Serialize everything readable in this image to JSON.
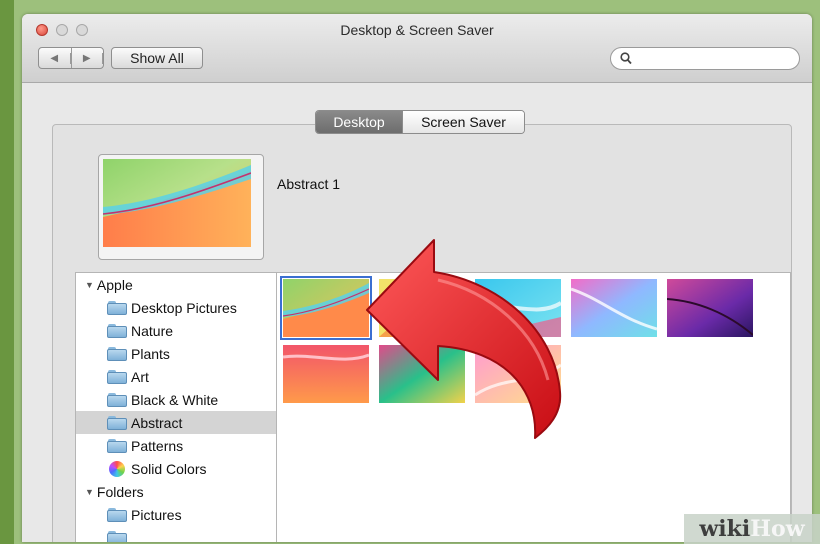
{
  "window": {
    "title": "Desktop & Screen Saver",
    "show_all_label": "Show All",
    "search_placeholder": ""
  },
  "tabs": [
    {
      "label": "Desktop",
      "selected": true
    },
    {
      "label": "Screen Saver",
      "selected": false
    }
  ],
  "current_wallpaper": {
    "name": "Abstract 1"
  },
  "sidebar": {
    "groups": [
      {
        "label": "Apple",
        "items": [
          {
            "label": "Desktop Pictures",
            "icon": "folder-icon"
          },
          {
            "label": "Nature",
            "icon": "folder-icon"
          },
          {
            "label": "Plants",
            "icon": "folder-icon"
          },
          {
            "label": "Art",
            "icon": "folder-icon"
          },
          {
            "label": "Black & White",
            "icon": "folder-icon"
          },
          {
            "label": "Abstract",
            "icon": "folder-icon",
            "selected": true
          },
          {
            "label": "Patterns",
            "icon": "folder-icon"
          },
          {
            "label": "Solid Colors",
            "icon": "color-wheel-icon"
          }
        ]
      },
      {
        "label": "Folders",
        "items": [
          {
            "label": "Pictures",
            "icon": "pictures-folder-icon"
          }
        ]
      }
    ]
  },
  "thumbnails": [
    {
      "name": "abstract-1",
      "selected": true
    },
    {
      "name": "abstract-2"
    },
    {
      "name": "abstract-3"
    },
    {
      "name": "abstract-4"
    },
    {
      "name": "abstract-5"
    },
    {
      "name": "abstract-6"
    },
    {
      "name": "abstract-7"
    },
    {
      "name": "abstract-8"
    }
  ],
  "overlay": {
    "arrow_color": "#e8141c"
  },
  "watermark": {
    "part1": "wiki",
    "part2": "How"
  }
}
